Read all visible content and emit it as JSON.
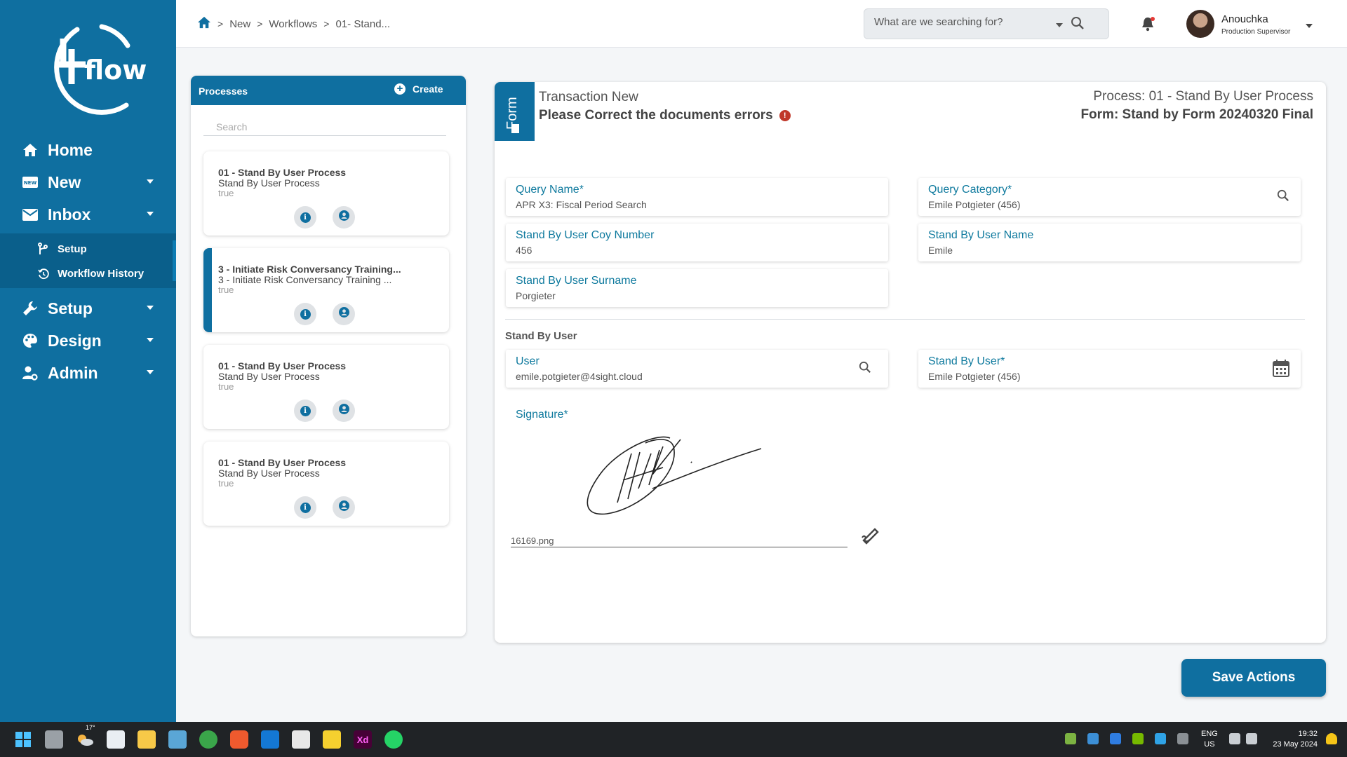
{
  "sidebar": {
    "logo_text": "flow",
    "items": [
      {
        "label": "Home",
        "icon": "home-icon"
      },
      {
        "label": "New",
        "icon": "new-badge-icon"
      },
      {
        "label": "Inbox",
        "icon": "envelope-icon"
      },
      {
        "label": "Setup",
        "icon": "wrench-icon"
      },
      {
        "label": "Design",
        "icon": "palette-icon"
      },
      {
        "label": "Admin",
        "icon": "user-cog-icon"
      }
    ],
    "submenu": [
      {
        "label": "Setup",
        "icon": "branch-icon"
      },
      {
        "label": "Workflow History",
        "icon": "history-icon"
      }
    ]
  },
  "header": {
    "breadcrumb": [
      "New",
      "Workflows",
      "01- Stand..."
    ],
    "search_placeholder": "What are we searching for?",
    "user_name": "Anouchka",
    "user_role": "Production Supervisor"
  },
  "processes": {
    "title": "Processes",
    "create_label": "Create",
    "search_placeholder": "Search",
    "cards": [
      {
        "title": "01 - Stand By User Process",
        "subtitle": "Stand By User Process",
        "status": "true"
      },
      {
        "title": "3 - Initiate Risk Conversancy Training...",
        "subtitle": "3 - Initiate Risk Conversancy Training ...",
        "status": "true"
      },
      {
        "title": "01 - Stand By User Process",
        "subtitle": "Stand By User Process",
        "status": "true"
      },
      {
        "title": "01 - Stand By User Process",
        "subtitle": "Stand By User Process",
        "status": "true"
      }
    ]
  },
  "form": {
    "tab_label": "Form",
    "transaction_title": "Transaction New",
    "error_message": "Please Correct the documents errors",
    "process_name": "Process: 01 - Stand By User Process",
    "form_name": "Form: Stand by Form 20240320 Final",
    "fields": {
      "query_name": {
        "label": "Query Name*",
        "value": "APR X3: Fiscal Period Search"
      },
      "query_category": {
        "label": "Query Category*",
        "value": "Emile Potgieter (456)"
      },
      "coy_number": {
        "label": "Stand By User Coy Number",
        "value": "456"
      },
      "user_name": {
        "label": "Stand By User Name",
        "value": "Emile"
      },
      "surname": {
        "label": "Stand By User Surname",
        "value": "Porgieter"
      },
      "user": {
        "label": "User",
        "value": "emile.potgieter@4sight.cloud"
      },
      "stand_by_user": {
        "label": "Stand By User*",
        "value": "Emile Potgieter (456)"
      }
    },
    "section_title": "Stand By User",
    "signature_label": "Signature*",
    "signature_file": "16169.png"
  },
  "save_label": "Save Actions",
  "taskbar": {
    "temperature": "17°",
    "xd_label": "Xd",
    "lang_1": "ENG",
    "lang_2": "US",
    "time": "19:32",
    "date": "23 May 2024"
  },
  "colors": {
    "brand": "#0f6fa0",
    "field_label": "#0f7a9e",
    "error": "#c0392b"
  }
}
